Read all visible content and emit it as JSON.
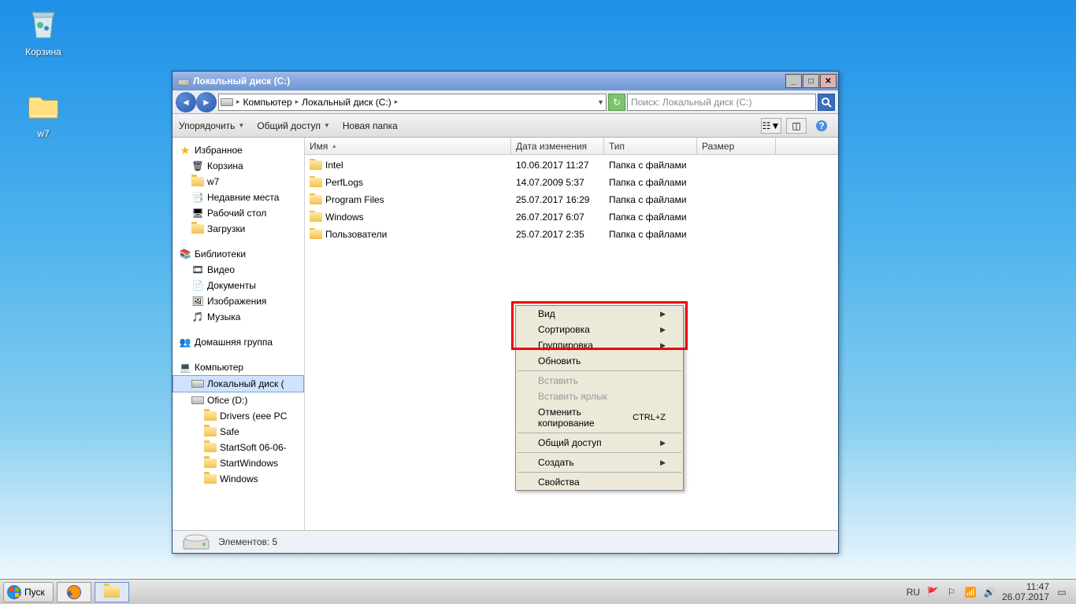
{
  "desktop": {
    "recycle_bin": "Корзина",
    "folder": "w7"
  },
  "window": {
    "title": "Локальный диск (C:)",
    "breadcrumb": [
      "Компьютер",
      "Локальный диск (C:)"
    ],
    "search_placeholder": "Поиск: Локальный диск (C:)",
    "toolbar": {
      "organize": "Упорядочить",
      "share": "Общий доступ",
      "new_folder": "Новая папка"
    },
    "columns": {
      "name": "Имя",
      "date": "Дата изменения",
      "type": "Тип",
      "size": "Размер"
    },
    "sidebar": {
      "favorites": "Избранное",
      "fav_items": [
        "Корзина",
        "w7",
        "Недавние места",
        "Рабочий стол",
        "Загрузки"
      ],
      "libraries": "Библиотеки",
      "lib_items": [
        "Видео",
        "Документы",
        "Изображения",
        "Музыка"
      ],
      "homegroup": "Домашняя группа",
      "computer": "Компьютер",
      "drives": [
        "Локальный диск (",
        "Ofice (D:)"
      ],
      "d_folders": [
        "Drivers (eee PC",
        "Safe",
        "StartSoft 06-06-",
        "StartWindows",
        "Windows"
      ]
    },
    "rows": [
      {
        "name": "Intel",
        "date": "10.06.2017 11:27",
        "type": "Папка с файлами"
      },
      {
        "name": "PerfLogs",
        "date": "14.07.2009 5:37",
        "type": "Папка с файлами"
      },
      {
        "name": "Program Files",
        "date": "25.07.2017 16:29",
        "type": "Папка с файлами"
      },
      {
        "name": "Windows",
        "date": "26.07.2017 6:07",
        "type": "Папка с файлами"
      },
      {
        "name": "Пользователи",
        "date": "25.07.2017 2:35",
        "type": "Папка с файлами"
      }
    ],
    "status": "Элементов: 5"
  },
  "context_menu": {
    "view": "Вид",
    "sort": "Сортировка",
    "group": "Группировка",
    "refresh": "Обновить",
    "paste": "Вставить",
    "paste_shortcut": "Вставить ярлык",
    "undo_copy": "Отменить копирование",
    "undo_key": "CTRL+Z",
    "share": "Общий доступ",
    "create": "Создать",
    "properties": "Свойства"
  },
  "taskbar": {
    "start": "Пуск",
    "lang": "RU",
    "time": "11:47",
    "date": "26.07.2017"
  }
}
